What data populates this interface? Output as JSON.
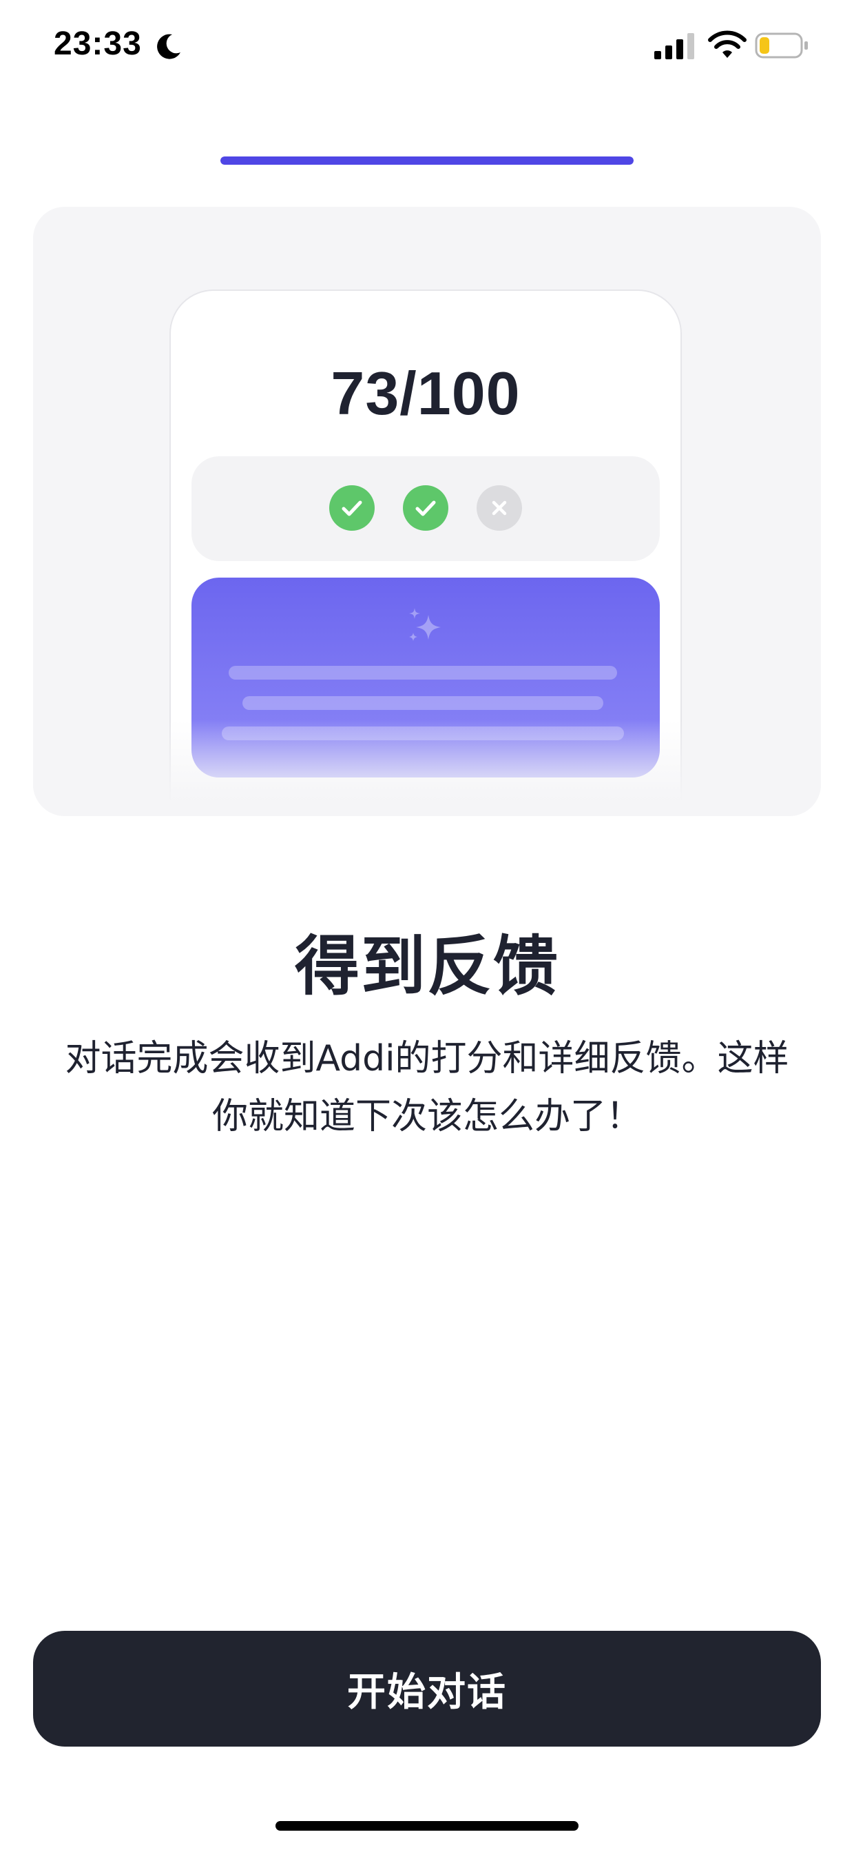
{
  "status_bar": {
    "time": "23:33",
    "icons": [
      "moon-icon",
      "signal-icon",
      "wifi-icon",
      "battery-icon"
    ],
    "battery_level": 0.25,
    "battery_color": "#f5c518"
  },
  "progress": {
    "value": 1.0,
    "color": "#4f46e5"
  },
  "illustration": {
    "score": "73/100",
    "checks": [
      {
        "state": "passed",
        "icon": "check-icon",
        "color": "#5ec76a"
      },
      {
        "state": "passed",
        "icon": "check-icon",
        "color": "#5ec76a"
      },
      {
        "state": "failed",
        "icon": "x-icon",
        "color": "#dcdcdf"
      }
    ],
    "feedback_icon": "sparkle-icon",
    "feedback_gradient": [
      "#6c66ef",
      "#8d88f7"
    ]
  },
  "content": {
    "title": "得到反馈",
    "description_line1": "对话完成会收到Addi的打分和详细反馈。这样",
    "description_line2": "你就知道下次该怎么办了！"
  },
  "cta": {
    "label": "开始对话",
    "color": "#21242f"
  }
}
